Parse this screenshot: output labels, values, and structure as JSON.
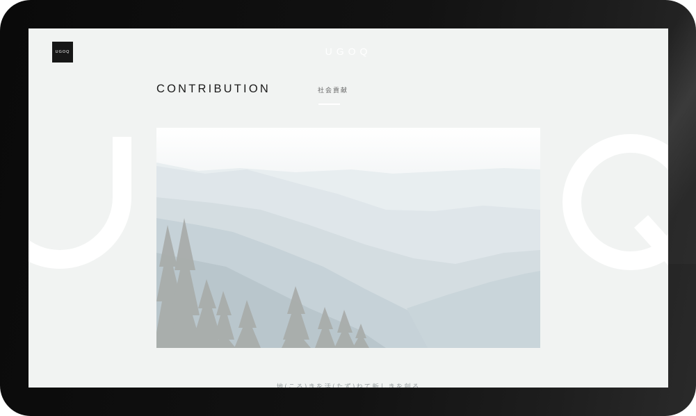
{
  "site": {
    "logo_small": "UGOQ",
    "logo_center": "UGOQ",
    "bg_letters": [
      "U",
      "Q"
    ]
  },
  "section": {
    "title": "CONTRIBUTION",
    "subtitle": "社会貢献"
  },
  "hero": {
    "image_subject": "misty mountain ranges with pine trees"
  },
  "caption": "地(ころ)きを活(たず)ねて新しきを創る",
  "colors": {
    "screen_bg": "#f1f3f2",
    "device_frame": "#0f0f0f",
    "logo_box": "#161616",
    "text_dark": "#1a1a1a",
    "text_muted": "#666666"
  }
}
